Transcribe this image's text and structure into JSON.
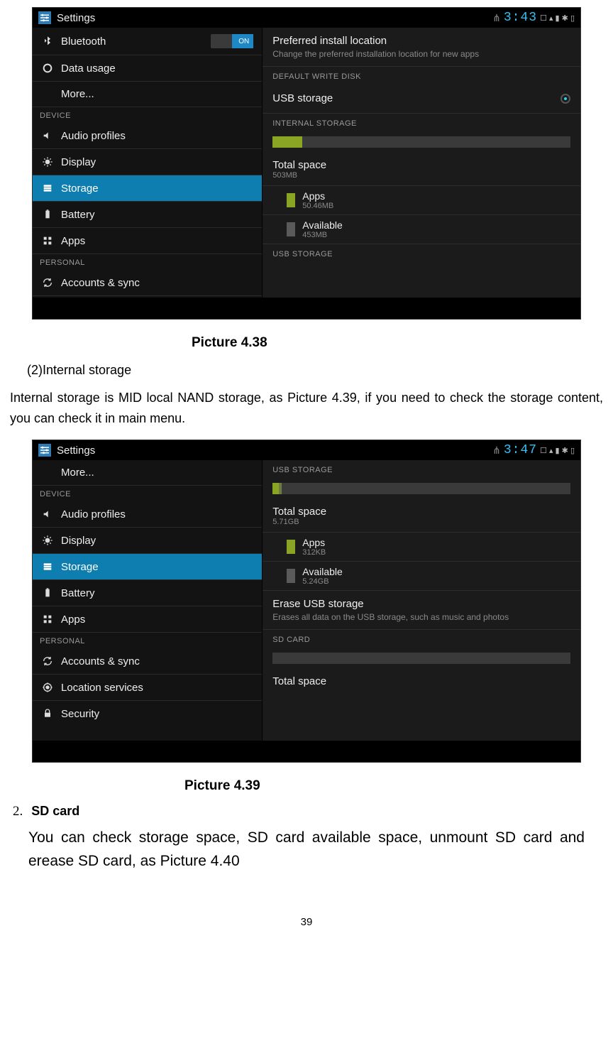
{
  "shot1": {
    "status": {
      "title": "Settings",
      "usb": "⋔",
      "clock": "3:43",
      "right_glyph": "☐ ▴ ▮ ✱ ▯"
    },
    "sidebar": {
      "items_top": [
        {
          "name": "bluetooth",
          "label": "Bluetooth",
          "toggle": "ON"
        },
        {
          "name": "data-usage",
          "label": "Data usage"
        },
        {
          "name": "more",
          "label": "More..."
        }
      ],
      "device_header": "DEVICE",
      "items_device": [
        {
          "name": "audio-profiles",
          "label": "Audio profiles"
        },
        {
          "name": "display",
          "label": "Display"
        },
        {
          "name": "storage",
          "label": "Storage",
          "selected": true
        },
        {
          "name": "battery",
          "label": "Battery"
        },
        {
          "name": "apps",
          "label": "Apps"
        }
      ],
      "personal_header": "PERSONAL",
      "items_personal": [
        {
          "name": "accounts-sync",
          "label": "Accounts & sync"
        }
      ]
    },
    "content": {
      "preferred_title": "Preferred install location",
      "preferred_sub": "Change the preferred installation location for new apps",
      "default_disk_header": "DEFAULT WRITE DISK",
      "usb_opt": "USB storage",
      "internal_header": "INTERNAL STORAGE",
      "bar_pct": 10,
      "total_label": "Total space",
      "total_value": "503MB",
      "apps_label": "Apps",
      "apps_value": "50.46MB",
      "avail_label": "Available",
      "avail_value": "453MB",
      "usb_header": "USB STORAGE"
    }
  },
  "shot2": {
    "status": {
      "title": "Settings",
      "usb": "⋔",
      "clock": "3:47",
      "right_glyph": "☐ ▴ ▮ ✱ ▯"
    },
    "sidebar": {
      "items_top": [
        {
          "name": "more",
          "label": "More..."
        }
      ],
      "device_header": "DEVICE",
      "items_device": [
        {
          "name": "audio-profiles",
          "label": "Audio profiles"
        },
        {
          "name": "display",
          "label": "Display"
        },
        {
          "name": "storage",
          "label": "Storage",
          "selected": true
        },
        {
          "name": "battery",
          "label": "Battery"
        },
        {
          "name": "apps",
          "label": "Apps"
        }
      ],
      "personal_header": "PERSONAL",
      "items_personal": [
        {
          "name": "accounts-sync",
          "label": "Accounts & sync"
        },
        {
          "name": "location-services",
          "label": "Location services"
        },
        {
          "name": "security",
          "label": "Security"
        }
      ]
    },
    "content": {
      "usb_header": "USB STORAGE",
      "bar_pct": 3,
      "total_label": "Total space",
      "total_value": "5.71GB",
      "apps_label": "Apps",
      "apps_value": "312KB",
      "avail_label": "Available",
      "avail_value": "5.24GB",
      "erase_title": "Erase USB storage",
      "erase_sub": "Erases all data on the USB storage, such as music and photos",
      "sd_header": "SD CARD",
      "sd_total_label": "Total space"
    }
  },
  "doc": {
    "caption1": "Picture 4.38",
    "para1": "(2)Internal storage",
    "para2": "Internal storage is MID local NAND storage, as Picture 4.39, if you need to check the storage content, you can check it in main menu.",
    "caption2": "Picture 4.39",
    "list_num": "2.",
    "list_title": "SD card",
    "para3": "You can check storage space, SD card available space, unmount SD card and erease SD card, as Picture 4.40",
    "pagenum": "39"
  }
}
